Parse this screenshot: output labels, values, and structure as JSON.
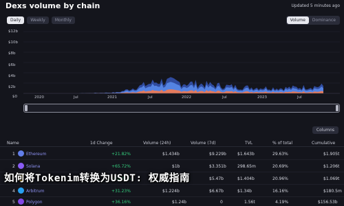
{
  "header": {
    "title": "Dexs volume by chain",
    "updated": "Updated 5 minutes ago"
  },
  "range_tabs": [
    "Daily",
    "Weekly",
    "Monthly"
  ],
  "active_range": "Daily",
  "metric_toggle": {
    "active": "Volume",
    "other": "Dominance"
  },
  "chart": {
    "y_ticks": [
      "$12b",
      "$10b",
      "$8b",
      "$6b",
      "$4b",
      "$2b",
      "$0"
    ],
    "x_ticks": [
      "2020",
      "Jul",
      "2021",
      "Jul",
      "2022",
      "Jul",
      "2023",
      "Jul"
    ],
    "colors": {
      "ethereum": "#5b8def",
      "bsc": "#ff7a45",
      "other": "#3a5ec9"
    }
  },
  "chart_data": {
    "type": "area",
    "x": [
      "2020",
      "Jul",
      "2021",
      "Jul",
      "2022",
      "Jul",
      "2023",
      "Jul"
    ],
    "series": [
      {
        "values": [
          0.0,
          0.0,
          0.2,
          2.4,
          1.8,
          1.2,
          1.0,
          1.4
        ]
      }
    ],
    "ylabel": "",
    "ylim": [
      0,
      12
    ],
    "y_unit": "$b",
    "stacked": true,
    "grid": true
  },
  "columns_button": "Columns",
  "table": {
    "headers": [
      "Name",
      "1d Change",
      "Volume (24h)",
      "Volume (7d)",
      "TVL",
      "% of total",
      "Cumulative"
    ],
    "rows": [
      {
        "rank": "1",
        "name": "Ethereum",
        "change": "+21.82%",
        "vol24": "$1.434b",
        "vol7": "$9.229b",
        "tvl": "$1.643b",
        "pct": "29.63%",
        "cum": "$1.905t",
        "icon_color": "#627eea"
      },
      {
        "rank": "2",
        "name": "Solana",
        "change": "+65.72%",
        "vol24": "$1b",
        "vol7": "$3.351b",
        "tvl": "298.65m",
        "pct": "20.69%",
        "cum": "$1.206t",
        "icon_color": "#8a5cf5"
      },
      {
        "rank": "3",
        "name": "BSC",
        "change": "+21.05%",
        "vol24": "$1.014b",
        "vol7": "$5.47b",
        "tvl": "$1.404b",
        "pct": "20.96%",
        "cum": "$1.069t",
        "icon_color": "#f0b90b"
      },
      {
        "rank": "4",
        "name": "Arbitrum",
        "change": "+31.23%",
        "vol24": "$1.224b",
        "vol7": "$6.67b",
        "tvl": "$1.34b",
        "pct": "16.16%",
        "cum": "$180.5m",
        "icon_color": "#28a0f0"
      },
      {
        "rank": "5",
        "name": "Polygon",
        "change": "+36.16%",
        "vol24": "$1.24b",
        "vol7": "0",
        "tvl": "1.56t",
        "pct": "4.19%",
        "cum": "$156.53b",
        "icon_color": "#8247e5"
      }
    ]
  },
  "overlay_text": "如何将Tokenim转换为USDT: 权威指南"
}
